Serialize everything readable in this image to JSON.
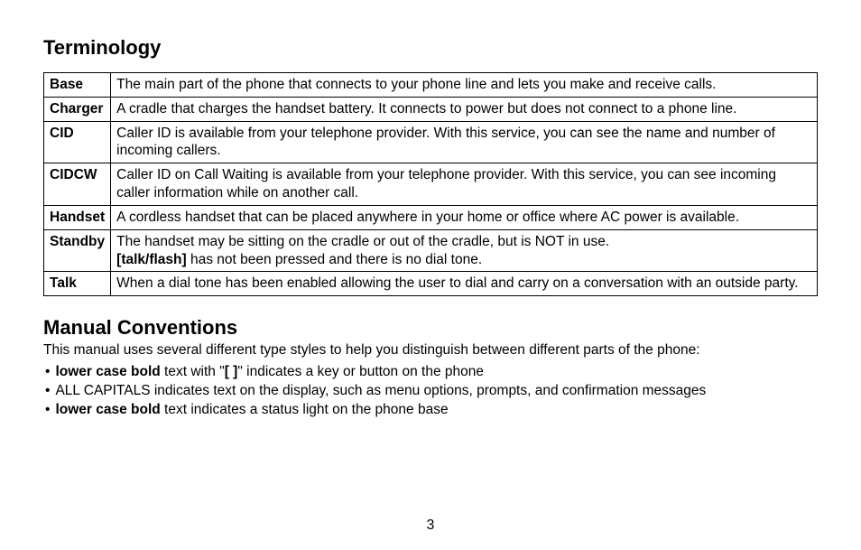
{
  "terminology": {
    "heading": "Terminology",
    "rows": [
      {
        "term": "Base",
        "def_html": "The main part of the phone that connects to your phone line and lets you make and receive calls."
      },
      {
        "term": "Charger",
        "def_html": "A cradle that charges the handset battery. It connects to power but does not connect to a phone line."
      },
      {
        "term": "CID",
        "def_html": "Caller ID is available from your telephone provider. With this service, you can see the name and number of incoming callers."
      },
      {
        "term": "CIDCW",
        "def_html": "Caller ID on Call Waiting is available from your telephone provider. With this service, you can see incoming caller information while on another call."
      },
      {
        "term": "Handset",
        "def_html": "A cordless handset that can be placed anywhere in your home or office where AC power is available."
      },
      {
        "term": "Standby",
        "def_html": "The handset may be sitting on the cradle or out of the cradle, but is NOT in use.<br><span class=\"b\">[talk/flash]</span> has not been pressed and there is no dial tone."
      },
      {
        "term": "Talk",
        "def_html": "When a dial tone has been enabled allowing the user to dial and carry on a conversation with an outside party."
      }
    ]
  },
  "conventions": {
    "heading": "Manual Conventions",
    "intro": "This manual uses several different type styles to help you distinguish between different parts of the phone:",
    "items": [
      "<span class=\"b\">lower case bold</span> text with \"<span class=\"b\">[ ]</span>\" indicates a key or button on the phone",
      "ALL CAPITALS indicates text on the display, such as menu options, prompts, and confirmation messages",
      "<span class=\"b\">lower case bold</span> text indicates a status light on the phone base"
    ]
  },
  "page_number": "3"
}
